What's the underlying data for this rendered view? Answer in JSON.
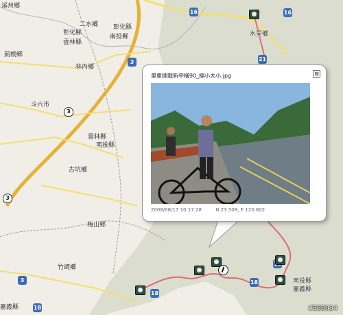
{
  "map": {
    "colors": {
      "background": "#f1eee7",
      "mountain_shade": "#d7dbc9",
      "yellow_road": "#f2df71",
      "highway": "#e4b238",
      "county_border": "#9a9a9a",
      "route": "#e06a78"
    },
    "labels": [
      "溪州鄉",
      "二水鄉",
      "彰化縣",
      "雲林縣",
      "彰化縣",
      "南投縣",
      "莿桐鄉",
      "林內鄉",
      "斗六市",
      "古坑鄉",
      "雲林縣",
      "南投縣",
      "梅山鄉",
      "竹崎鄉",
      "嘉義縣",
      "水里鄉",
      "南投縣",
      "嘉義縣"
    ],
    "shields": [
      {
        "text": "16",
        "style": "blue"
      },
      {
        "text": "21",
        "style": "blue"
      },
      {
        "text": "3",
        "style": "blue"
      },
      {
        "text": "3",
        "style": "prov"
      },
      {
        "text": "3",
        "style": "prov"
      },
      {
        "text": "3",
        "style": "blue"
      },
      {
        "text": "18",
        "style": "blue"
      },
      {
        "text": "18",
        "style": "blue"
      },
      {
        "text": "18",
        "style": "blue"
      },
      {
        "text": "16",
        "style": "blue"
      },
      {
        "text": "16",
        "style": "blue"
      }
    ],
    "icons": [
      "camera-icon",
      "camera-icon",
      "camera-icon",
      "camera-icon",
      "camera-icon",
      "camera-icon",
      "bicycle-icon"
    ],
    "popup": {
      "title": "單車挑戰新中橫90_縮小大小.jpg",
      "close": "⊠",
      "photo_description_colors": {
        "sky": "#89b6df",
        "trees": "#3a6a3a",
        "road": "#6f7d86",
        "rail": "#a24a2a"
      },
      "timestamp": "2008/08/17 10:17:28",
      "coordinates": "N 23.508, E 120.802"
    },
    "watermark": "#559034"
  }
}
